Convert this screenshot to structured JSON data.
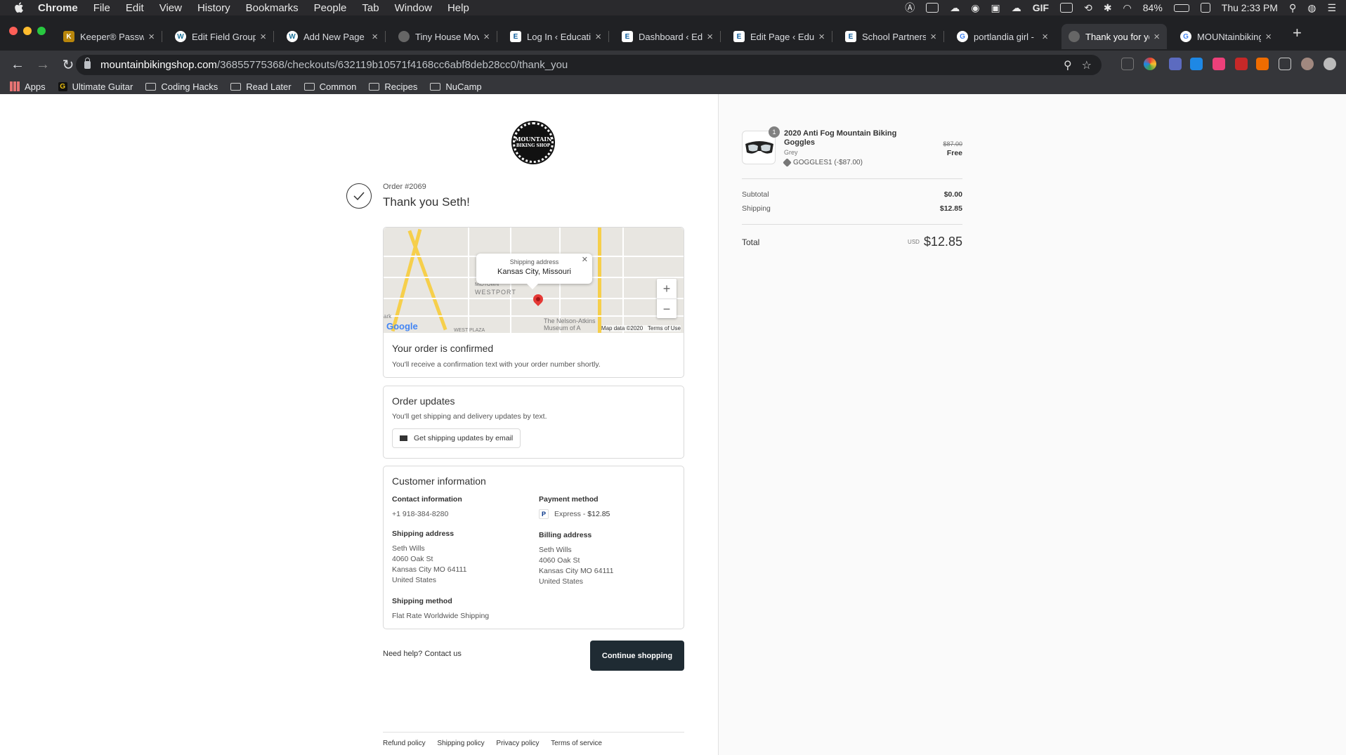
{
  "menubar": {
    "app": "Chrome",
    "items": [
      "File",
      "Edit",
      "View",
      "History",
      "Bookmarks",
      "People",
      "Tab",
      "Window",
      "Help"
    ],
    "battery": "84%",
    "clock": "Thu 2:33 PM"
  },
  "tabs": [
    {
      "title": "Keeper® Password",
      "icon": "keeper-icon"
    },
    {
      "title": "Edit Field Group",
      "icon": "wordpress-icon"
    },
    {
      "title": "Add New Page ‹",
      "icon": "wordpress-icon"
    },
    {
      "title": "Tiny House Mov",
      "icon": "globe-icon"
    },
    {
      "title": "Log In ‹ Educatio",
      "icon": "education-icon"
    },
    {
      "title": "Dashboard ‹ Edu",
      "icon": "education-icon"
    },
    {
      "title": "Edit Page ‹ Educ",
      "icon": "education-icon"
    },
    {
      "title": "School Partnersh",
      "icon": "education-icon"
    },
    {
      "title": "portlandia girl -",
      "icon": "google-icon"
    },
    {
      "title": "Thank you for yo",
      "icon": "globe-icon",
      "active": true
    },
    {
      "title": "MOUNtainbiking",
      "icon": "google-icon"
    }
  ],
  "address": {
    "domain": "mountainbikingshop.com",
    "path": "/36855775368/checkouts/632119b10571f4168cc6abf8deb28cc0/thank_you"
  },
  "bookmarks": [
    "Apps",
    "Ultimate Guitar",
    "Coding Hacks",
    "Read Later",
    "Common",
    "Recipes",
    "NuCamp"
  ],
  "shop": {
    "logo_line1": "MOUNTAIN",
    "logo_line2": "BIKING SHOP"
  },
  "order": {
    "number": "Order #2069",
    "thanks": "Thank you Seth!"
  },
  "map": {
    "bubble_title": "Shipping address",
    "bubble_place": "Kansas City, Missouri",
    "attribution": "Map data ©2020",
    "terms": "Terms of Use",
    "google": "Google",
    "labels": {
      "westport": "WESTPORT",
      "midtown": "MIDTOWN",
      "nelson": "The Nelson-Atkins",
      "museum": "Museum of A",
      "westplaza": "WEST PLAZA",
      "ark": "ark"
    }
  },
  "confirmed": {
    "title": "Your order is confirmed",
    "text": "You'll receive a confirmation text with your order number shortly."
  },
  "updates": {
    "title": "Order updates",
    "text": "You'll get shipping and delivery updates by text.",
    "button": "Get shipping updates by email"
  },
  "customer": {
    "title": "Customer information",
    "contact_label": "Contact information",
    "contact": "+1 918-384-8280",
    "payment_label": "Payment method",
    "payment": "Express - ",
    "payment_amount": "$12.85",
    "shipping_label": "Shipping address",
    "shipping": [
      "Seth Wills",
      "4060 Oak St",
      "Kansas City MO 64111",
      "United States"
    ],
    "billing_label": "Billing address",
    "billing": [
      "Seth Wills",
      "4060 Oak St",
      "Kansas City MO 64111",
      "United States"
    ],
    "method_label": "Shipping method",
    "method": "Flat Rate Worldwide Shipping"
  },
  "help": {
    "text": "Need help? ",
    "link": "Contact us"
  },
  "continue_button": "Continue shopping",
  "footer": [
    "Refund policy",
    "Shipping policy",
    "Privacy policy",
    "Terms of service"
  ],
  "summary": {
    "quantity": "1",
    "product": "2020 Anti Fog Mountain Biking Goggles",
    "variant": "Grey",
    "discount": "GOGGLES1 (-$87.00)",
    "original_price": "$87.00",
    "price": "Free",
    "subtotal_label": "Subtotal",
    "subtotal": "$0.00",
    "shipping_label": "Shipping",
    "shipping": "$12.85",
    "total_label": "Total",
    "currency": "USD",
    "total": "$12.85"
  }
}
